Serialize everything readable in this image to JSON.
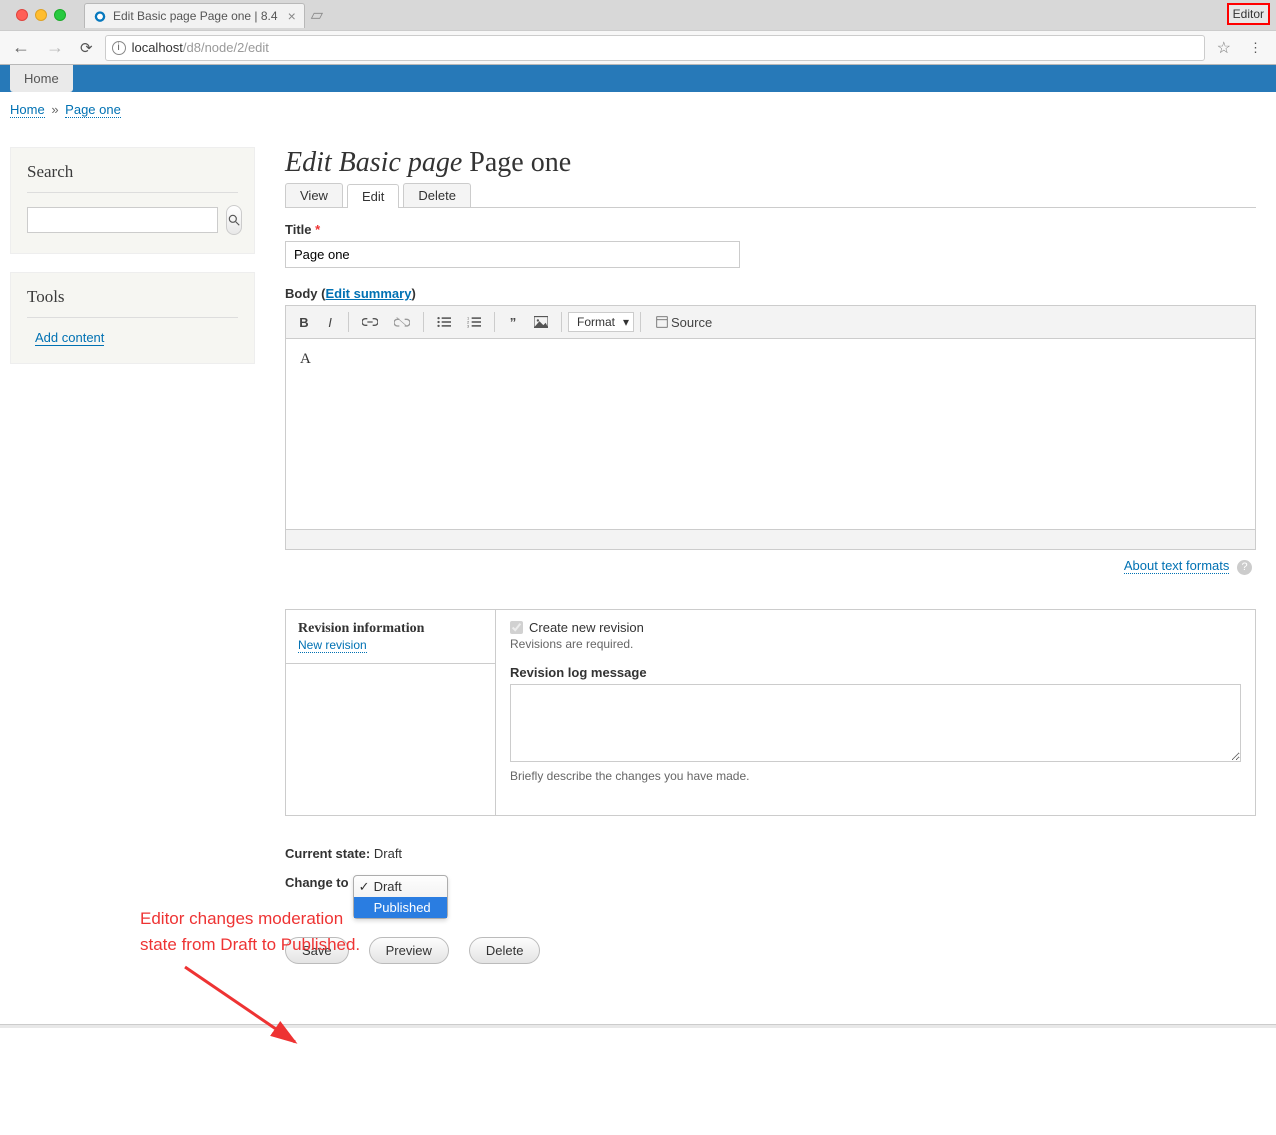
{
  "browser": {
    "tab_title": "Edit Basic page Page one | 8.4",
    "editor_badge": "Editor",
    "url_host": "localhost",
    "url_path": "/d8/node/2/edit"
  },
  "strip": {
    "home": "Home"
  },
  "breadcrumb": {
    "home": "Home",
    "sep": "»",
    "current": "Page one"
  },
  "sidebar": {
    "search_title": "Search",
    "tools_title": "Tools",
    "add_content": "Add content"
  },
  "page": {
    "title_prefix": "Edit Basic page",
    "title_suffix": "Page one",
    "tabs": {
      "view": "View",
      "edit": "Edit",
      "delete": "Delete"
    },
    "title_label": "Title",
    "title_value": "Page one",
    "body_label": "Body",
    "edit_summary": "Edit summary",
    "body_content": "A",
    "format_label": "Format",
    "source_label": "Source",
    "about_formats": "About text formats"
  },
  "revision": {
    "heading": "Revision information",
    "sub": "New revision",
    "create_new": "Create new revision",
    "required_note": "Revisions are required.",
    "log_label": "Revision log message",
    "log_help": "Briefly describe the changes you have made."
  },
  "state": {
    "current_label": "Current state:",
    "current_value": "Draft",
    "change_label": "Change to",
    "options": {
      "draft": "Draft",
      "published": "Published"
    }
  },
  "actions": {
    "save": "Save",
    "preview": "Preview",
    "delete": "Delete"
  },
  "annotation": {
    "line1": "Editor changes moderation",
    "line2": "state from Draft to Published."
  }
}
